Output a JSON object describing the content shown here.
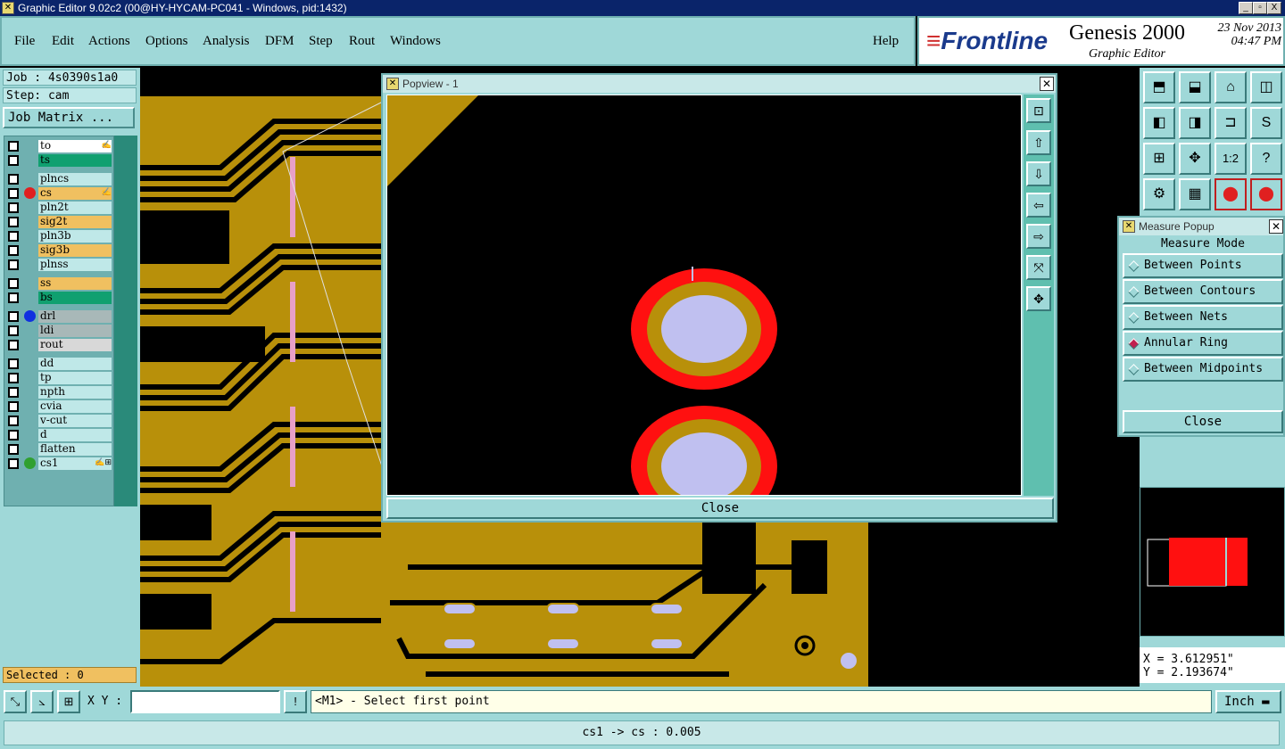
{
  "window": {
    "title": "Graphic Editor 9.02c2 (00@HY-HYCAM-PC041 - Windows, pid:1432)",
    "controls": [
      "_",
      "▫",
      "X"
    ]
  },
  "menu": {
    "items": [
      "File",
      "Edit",
      "Actions",
      "Options",
      "Analysis",
      "DFM",
      "Step",
      "Rout",
      "Windows"
    ],
    "help": "Help"
  },
  "logo": {
    "brand": "Frontline",
    "product": "Genesis 2000",
    "subtitle": "Graphic Editor",
    "date": "23 Nov 2013",
    "time": "04:47 PM"
  },
  "job": {
    "job_label": "Job : 4s0390s1a0",
    "step_label": "Step: cam",
    "matrix_button": "Job Matrix ..."
  },
  "layers": [
    {
      "name": "to",
      "bg": "#ffffff",
      "dot": "",
      "edit": "✍"
    },
    {
      "name": "ts",
      "bg": "#10a070",
      "dot": "",
      "edit": ""
    },
    {
      "name": "plncs",
      "bg": "#bfe8e8",
      "dot": "",
      "edit": ""
    },
    {
      "name": "cs",
      "bg": "#f0c060",
      "dot": "#e02020",
      "edit": "✍"
    },
    {
      "name": "pln2t",
      "bg": "#bfe8e8",
      "dot": "",
      "edit": ""
    },
    {
      "name": "sig2t",
      "bg": "#f0c060",
      "dot": "",
      "edit": ""
    },
    {
      "name": "pln3b",
      "bg": "#bfe8e8",
      "dot": "",
      "edit": ""
    },
    {
      "name": "sig3b",
      "bg": "#f0c060",
      "dot": "",
      "edit": ""
    },
    {
      "name": "plnss",
      "bg": "#bfe8e8",
      "dot": "",
      "edit": ""
    },
    {
      "name": "ss",
      "bg": "#f0c060",
      "dot": "",
      "edit": ""
    },
    {
      "name": "bs",
      "bg": "#10a070",
      "dot": "",
      "edit": ""
    },
    {
      "name": "drl",
      "bg": "#a8b8b8",
      "dot": "#1030e0",
      "edit": ""
    },
    {
      "name": "ldi",
      "bg": "#a8b8b8",
      "dot": "",
      "edit": ""
    },
    {
      "name": "rout",
      "bg": "#d8d8d8",
      "dot": "",
      "edit": ""
    },
    {
      "name": "dd",
      "bg": "#bfe8e8",
      "dot": "",
      "edit": ""
    },
    {
      "name": "tp",
      "bg": "#bfe8e8",
      "dot": "",
      "edit": ""
    },
    {
      "name": "npth",
      "bg": "#bfe8e8",
      "dot": "",
      "edit": ""
    },
    {
      "name": "cvia",
      "bg": "#bfe8e8",
      "dot": "",
      "edit": ""
    },
    {
      "name": "v-cut",
      "bg": "#bfe8e8",
      "dot": "",
      "edit": ""
    },
    {
      "name": "d",
      "bg": "#bfe8e8",
      "dot": "",
      "edit": ""
    },
    {
      "name": "flatten",
      "bg": "#bfe8e8",
      "dot": "",
      "edit": ""
    },
    {
      "name": "cs1",
      "bg": "#bfe8e8",
      "dot": "#30a030",
      "edit": "✍⊞"
    }
  ],
  "selected": "Selected : 0",
  "popview": {
    "title": "Popview - 1",
    "close_label": "Close",
    "tools": [
      "zoom-fit-icon",
      "pan-up-icon",
      "pan-down-icon",
      "pan-left-icon",
      "pan-right-icon",
      "zoom-in-icon",
      "zoom-out-icon"
    ]
  },
  "right_tools": [
    "pan-up-icon",
    "pan-down-icon",
    "home-icon",
    "split-view-icon",
    "pan-left-icon",
    "pan-right-icon",
    "snap-icon",
    "s-curve-icon",
    "zoom-in-icon",
    "zoom-out-icon",
    "scale-1-2-icon",
    "help-icon",
    "settings-icon",
    "grid-icon",
    "layer-red-icon",
    "layer-red-2-icon"
  ],
  "measure": {
    "title": "Measure Popup",
    "mode_label": "Measure Mode",
    "options": [
      "Between Points",
      "Between Contours",
      "Between Nets",
      "Annular Ring",
      "Between Midpoints"
    ],
    "selected_index": 3,
    "close_label": "Close"
  },
  "coords": {
    "x": "X = 3.612951\"",
    "y": "Y = 2.193674\""
  },
  "statusbar": {
    "xy_label": "X Y :",
    "xy_value": "",
    "alert": "!",
    "message": "<M1> - Select first point",
    "units": "Inch"
  },
  "bottom_message": "cs1 -> cs : 0.005",
  "colors": {
    "copper": "#b8900a",
    "pad_fill": "#c0c0f0",
    "ring": "#ff1010",
    "panel": "#9fd8d8"
  }
}
